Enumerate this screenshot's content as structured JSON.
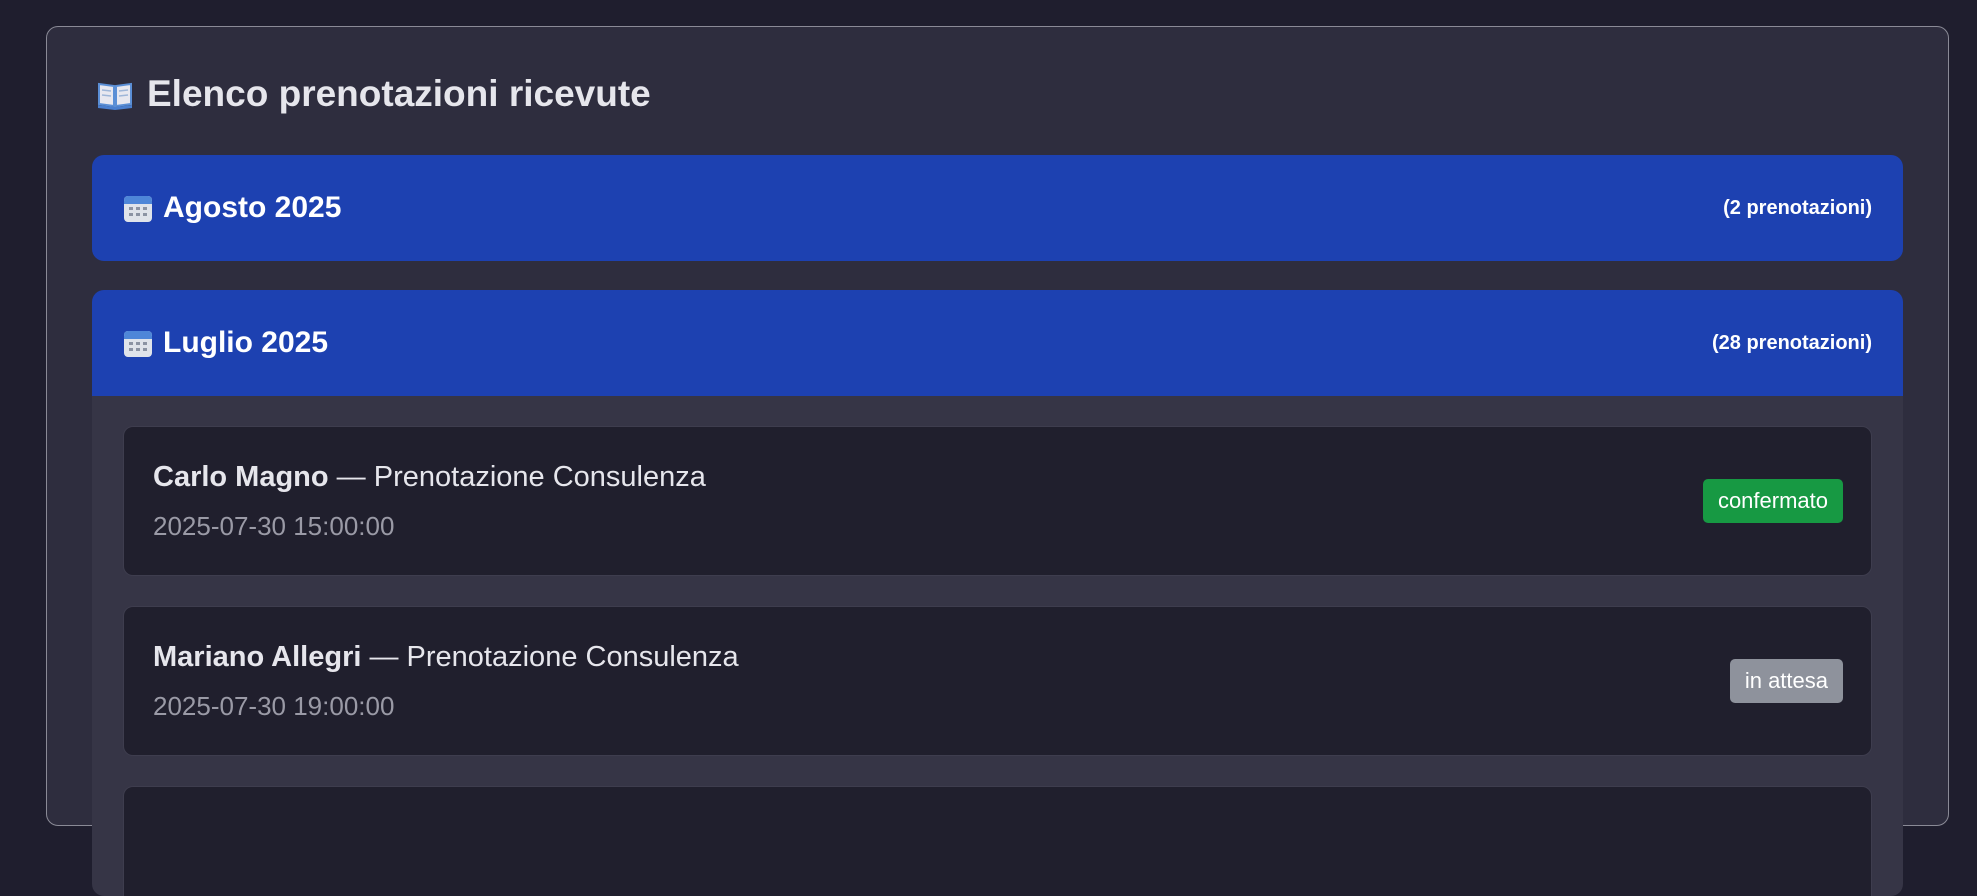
{
  "page": {
    "title": "Elenco prenotazioni ricevute",
    "title_icon": "open-book-icon"
  },
  "months": [
    {
      "title": "Agosto 2025",
      "count": "(2 prenotazioni)",
      "icon": "calendar-icon"
    },
    {
      "title": "Luglio 2025",
      "count": "(28 prenotazioni)",
      "icon": "calendar-icon",
      "bookings": [
        {
          "name": "Carlo Magno",
          "separator": " — ",
          "service": "Prenotazione Consulenza",
          "datetime": "2025-07-30 15:00:00",
          "status": "confermato"
        },
        {
          "name": "Mariano Allegri",
          "separator": " — ",
          "service": "Prenotazione Consulenza",
          "datetime": "2025-07-30 19:00:00",
          "status": "in attesa"
        }
      ]
    }
  ],
  "colors": {
    "month_header": "#1d41b1",
    "status_confirmed": "#179943",
    "status_pending": "#8e929c"
  }
}
